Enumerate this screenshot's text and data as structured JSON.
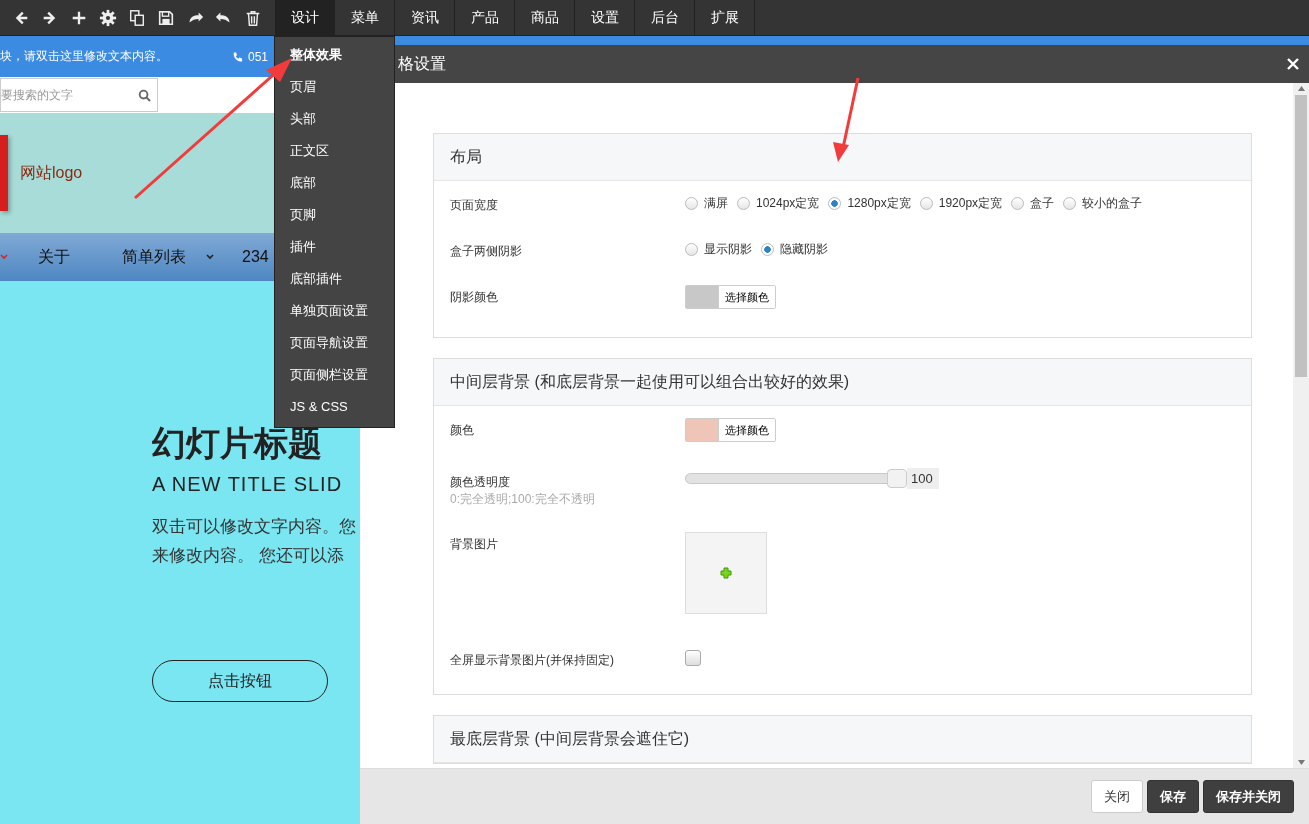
{
  "toolbar": {
    "tabs": [
      {
        "label": "设计",
        "selected": true
      },
      {
        "label": "菜单",
        "selected": false
      },
      {
        "label": "资讯",
        "selected": false
      },
      {
        "label": "产品",
        "selected": false
      },
      {
        "label": "商品",
        "selected": false
      },
      {
        "label": "设置",
        "selected": false
      },
      {
        "label": "后台",
        "selected": false
      },
      {
        "label": "扩展",
        "selected": false
      }
    ]
  },
  "design_menu": [
    {
      "label": "整体效果",
      "selected": true
    },
    {
      "label": "页眉",
      "selected": false
    },
    {
      "label": "头部",
      "selected": false
    },
    {
      "label": "正文区",
      "selected": false
    },
    {
      "label": "底部",
      "selected": false
    },
    {
      "label": "页脚",
      "selected": false
    },
    {
      "label": "插件",
      "selected": false
    },
    {
      "label": "底部插件",
      "selected": false
    },
    {
      "label": "单独页面设置",
      "selected": false
    },
    {
      "label": "页面导航设置",
      "selected": false
    },
    {
      "label": "页面侧栏设置",
      "selected": false
    },
    {
      "label": "JS & CSS",
      "selected": false
    }
  ],
  "site_preview": {
    "notice": "块，请双击这里修改文本内容。",
    "phone": "051",
    "search": {
      "placeholder": "要搜索的文字"
    },
    "logo": "网站logo",
    "nav": [
      {
        "label": "关于",
        "dropdown": false
      },
      {
        "label": "简单列表",
        "dropdown": true
      },
      {
        "label": "234",
        "dropdown": false
      }
    ],
    "slide": {
      "title": "幻灯片标题",
      "subtitle": "A NEW TITLE SLID",
      "text": [
        "双击可以修改文字内容。您",
        "来修改内容。 您还可以添"
      ],
      "button": "点击按钮"
    }
  },
  "dialog": {
    "title": "格设置",
    "sections": [
      {
        "title": "布局",
        "rows": [
          {
            "kind": "radio",
            "label": "页面宽度",
            "options": [
              {
                "label": "满屏",
                "selected": false
              },
              {
                "label": "1024px定宽",
                "selected": false
              },
              {
                "label": "1280px定宽",
                "selected": true
              },
              {
                "label": "1920px定宽",
                "selected": false
              },
              {
                "label": "盒子",
                "selected": false
              },
              {
                "label": "较小的盒子",
                "selected": false
              }
            ]
          },
          {
            "kind": "radio",
            "label": "盒子两侧阴影",
            "options": [
              {
                "label": "显示阴影",
                "selected": false
              },
              {
                "label": "隐藏阴影",
                "selected": true
              }
            ]
          },
          {
            "kind": "color",
            "label": "阴影颜色",
            "color": "#c8c8c8",
            "button": "选择颜色"
          }
        ]
      },
      {
        "title": "中间层背景 (和底层背景一起使用可以组合出较好的效果)",
        "rows": [
          {
            "kind": "color",
            "label": "颜色",
            "color": "#efc5b7",
            "button": "选择颜色"
          },
          {
            "kind": "slider",
            "label": "颜色透明度",
            "hint": "0:完全透明;100:完全不透明",
            "level": 1,
            "value": "100"
          },
          {
            "kind": "image",
            "label": "背景图片"
          },
          {
            "kind": "checkbox",
            "label": "全屏显示背景图片(并保持固定)",
            "checked": false
          }
        ]
      },
      {
        "title": "最底层背景 (中间层背景会遮住它)"
      }
    ],
    "buttons": [
      {
        "label": "关闭",
        "kind": "default"
      },
      {
        "label": "保存",
        "kind": "primary"
      },
      {
        "label": "保存并关闭",
        "kind": "primary"
      }
    ]
  }
}
